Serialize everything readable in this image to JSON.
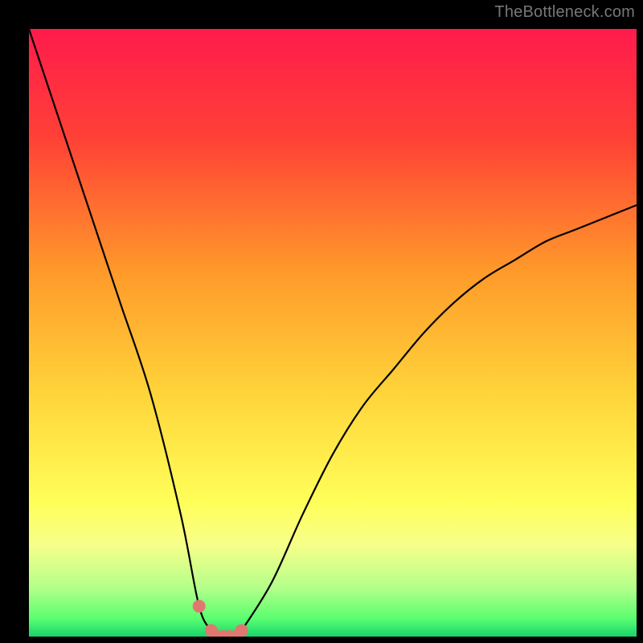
{
  "attribution": "TheBottleneck.com",
  "chart_data": {
    "type": "line",
    "title": "",
    "xlabel": "",
    "ylabel": "",
    "x": [
      0,
      5,
      10,
      15,
      20,
      25,
      28,
      30,
      31,
      32,
      33,
      34,
      35,
      40,
      45,
      50,
      55,
      60,
      65,
      70,
      75,
      80,
      85,
      90,
      95,
      100
    ],
    "values": [
      100,
      85,
      70,
      55,
      40,
      20,
      5,
      1,
      0,
      0,
      0,
      0,
      1,
      9,
      20,
      30,
      38,
      44,
      50,
      55,
      59,
      62,
      65,
      67,
      69,
      71
    ],
    "ylim": [
      0,
      100
    ],
    "xlim": [
      0,
      100
    ],
    "markers": [
      {
        "x": 28,
        "y": 5
      },
      {
        "x": 30,
        "y": 1
      },
      {
        "x": 31,
        "y": 0
      },
      {
        "x": 32,
        "y": 0
      },
      {
        "x": 33,
        "y": 0
      },
      {
        "x": 34,
        "y": 0
      },
      {
        "x": 35,
        "y": 1
      }
    ],
    "gradient_stops": [
      {
        "offset": 0,
        "color": "#ff1b4c"
      },
      {
        "offset": 18,
        "color": "#ff4136"
      },
      {
        "offset": 40,
        "color": "#ff9a2a"
      },
      {
        "offset": 60,
        "color": "#ffd43a"
      },
      {
        "offset": 78,
        "color": "#ffff59"
      },
      {
        "offset": 85,
        "color": "#f6ff8a"
      },
      {
        "offset": 92,
        "color": "#b3ff8a"
      },
      {
        "offset": 97,
        "color": "#5bff70"
      },
      {
        "offset": 100,
        "color": "#18d46b"
      }
    ],
    "marker_color": "#e17771",
    "curve_color": "#000000"
  }
}
